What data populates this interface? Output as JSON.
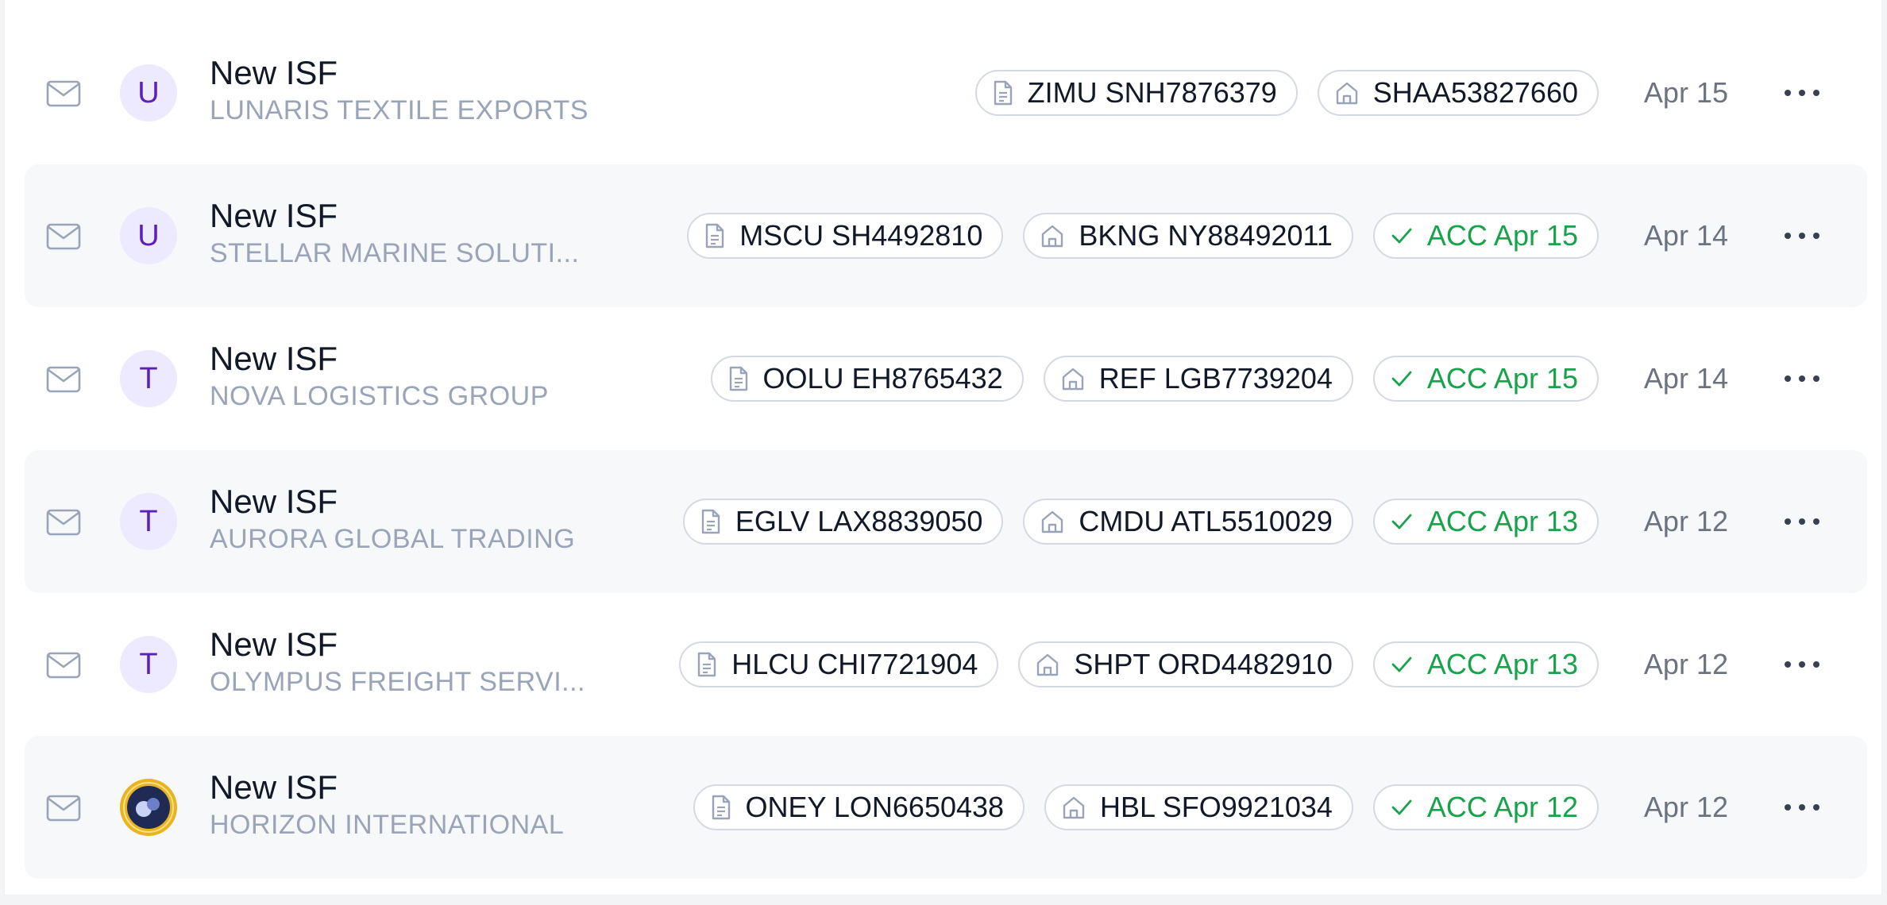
{
  "rows": [
    {
      "avatar": "U",
      "title": "New ISF",
      "subtitle": "LUNARIS TEXTILE EXPORTS",
      "bill": "ZIMU SNH7876379",
      "booking": "SHAA53827660",
      "status": null,
      "date": "Apr 15"
    },
    {
      "avatar": "U",
      "title": "New ISF",
      "subtitle": "STELLAR MARINE SOLUTI...",
      "bill": "MSCU SH4492810",
      "booking": "BKNG NY88492011",
      "status": "ACC Apr 15",
      "date": "Apr 14"
    },
    {
      "avatar": "T",
      "title": "New ISF",
      "subtitle": "NOVA LOGISTICS GROUP",
      "bill": "OOLU EH8765432",
      "booking": "REF LGB7739204",
      "status": "ACC Apr 15",
      "date": "Apr 14"
    },
    {
      "avatar": "T",
      "title": "New ISF",
      "subtitle": "AURORA GLOBAL TRADING",
      "bill": "EGLV LAX8839050",
      "booking": "CMDU ATL5510029",
      "status": "ACC Apr 13",
      "date": "Apr 12"
    },
    {
      "avatar": "T",
      "title": "New ISF",
      "subtitle": "OLYMPUS FREIGHT SERVI...",
      "bill": "HLCU CHI7721904",
      "booking": "SHPT ORD4482910",
      "status": "ACC Apr 13",
      "date": "Apr 12"
    },
    {
      "avatar": "logo",
      "title": "New ISF",
      "subtitle": "HORIZON INTERNATIONAL",
      "bill": "ONEY LON6650438",
      "booking": "HBL SFO9921034",
      "status": "ACC Apr 12",
      "date": "Apr 12"
    }
  ],
  "icons": {
    "row_icon": "mail-icon",
    "bill_icon": "document-icon",
    "booking_icon": "home-icon",
    "status_icon": "checkmark-icon",
    "menu_icon": "more-horizontal-icon"
  },
  "colors": {
    "status_green": "#16a34a",
    "avatar_bg": "#ede9fe",
    "avatar_text": "#5b21b6"
  }
}
